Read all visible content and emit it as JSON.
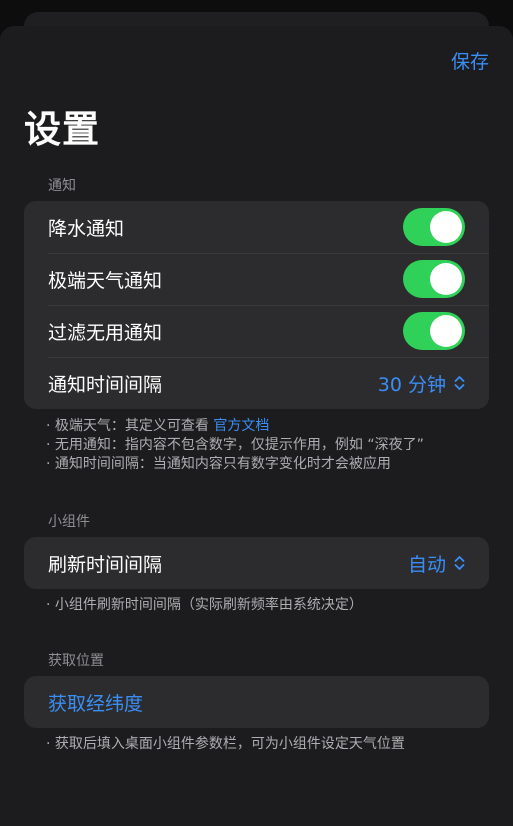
{
  "header": {
    "save_label": "保存",
    "title": "设置"
  },
  "notifications": {
    "section_label": "通知",
    "rows": [
      {
        "label": "降水通知",
        "enabled": true
      },
      {
        "label": "极端天气通知",
        "enabled": true
      },
      {
        "label": "过滤无用通知",
        "enabled": true
      }
    ],
    "interval": {
      "label": "通知时间间隔",
      "value": "30 分钟"
    },
    "notes": {
      "extreme_prefix": "· 极端天气：其定义可查看 ",
      "extreme_link": "官方文档",
      "useless": "· 无用通知：指内容不包含数字，仅提示作用，例如 “深夜了”",
      "interval": "· 通知时间间隔：当通知内容只有数字变化时才会被应用"
    }
  },
  "widget": {
    "section_label": "小组件",
    "refresh": {
      "label": "刷新时间间隔",
      "value": "自动"
    },
    "note": "· 小组件刷新时间间隔（实际刷新频率由系统决定）"
  },
  "location": {
    "section_label": "获取位置",
    "action_label": "获取经纬度",
    "note": "· 获取后填入桌面小组件参数栏，可为小组件设定天气位置"
  },
  "colors": {
    "accent": "#3a8ef5",
    "toggle_on": "#30d158",
    "group_bg": "#2c2c2e",
    "sheet_bg": "#1c1c1e"
  }
}
